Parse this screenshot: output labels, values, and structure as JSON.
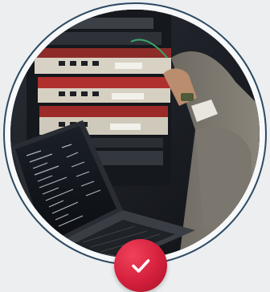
{
  "image": {
    "subject": "photo-server-rack-technician-laptop",
    "badge_icon": "check-icon"
  },
  "colors": {
    "ring": "#2d4a63",
    "badge": "#d41f3c",
    "background": "#eceef0"
  }
}
